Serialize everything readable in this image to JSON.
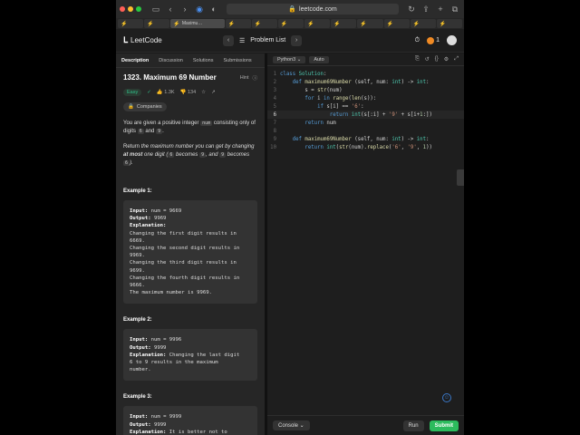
{
  "browser": {
    "url": "leetcode.com",
    "active_tab": "Maximu…",
    "tab_count_other": 11
  },
  "header": {
    "logo": "LeetCode",
    "problem_list": "Problem List",
    "streak": "1"
  },
  "left_tabs": [
    "Description",
    "Discussion",
    "Solutions",
    "Submissions"
  ],
  "problem": {
    "title": "1323. Maximum 69 Number",
    "hint": "Hint",
    "difficulty": "Easy",
    "likes": "1.3K",
    "dislikes": "134",
    "companies": "Companies",
    "p1_a": "You are given a positive integer ",
    "p1_code": "num",
    "p1_b": " consisting only of digits ",
    "p1_d6": "6",
    "p1_and": " and ",
    "p1_d9": "9",
    "p1_end": ".",
    "p2_a": "Return ",
    "p2_b": "the maximum number you can get by changing ",
    "p2_c": "at most",
    "p2_d": " one digit (",
    "p2_e": "6",
    "p2_f": " becomes ",
    "p2_g": "9",
    "p2_h": ", and ",
    "p2_i": "9",
    "p2_j": " becomes ",
    "p2_k": "6",
    "p2_l": ")."
  },
  "examples": [
    {
      "heading": "Example 1:",
      "input": "num = 9669",
      "output": "9969",
      "explanation_lines": [
        "Changing the first digit results in",
        "6669.",
        "Changing the second digit results in",
        "9969.",
        "Changing the third digit results in",
        "9699.",
        "Changing the fourth digit results in",
        "9666.",
        "The maximum number is 9969."
      ]
    },
    {
      "heading": "Example 2:",
      "input": "num = 9996",
      "output": "9999",
      "explanation_inline": "Changing the last digit",
      "explanation_lines": [
        "6 to 9 results in the maximum",
        "number."
      ]
    },
    {
      "heading": "Example 3:",
      "input": "num = 9999",
      "output": "9999",
      "explanation_inline": "It is better not to"
    }
  ],
  "labels": {
    "input": "Input:",
    "output": "Output:",
    "explanation": "Explanation:"
  },
  "editor": {
    "language": "Python3",
    "mode": "Auto",
    "line_numbers": [
      "1",
      "2",
      "3",
      "4",
      "5",
      "6",
      "7",
      "8",
      "9",
      "10"
    ]
  },
  "footer": {
    "console": "Console",
    "run": "Run",
    "submit": "Submit"
  },
  "colors": {
    "submit": "#2cbb5d",
    "easy": "#2fc08a",
    "accent": "#f0a020"
  }
}
